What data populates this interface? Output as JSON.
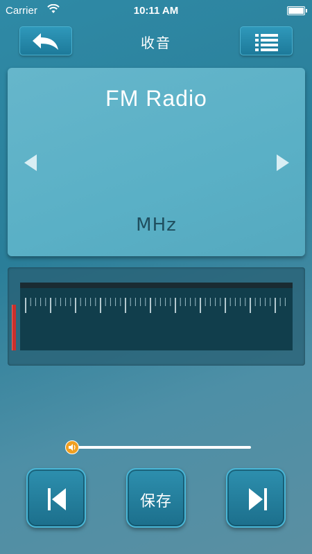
{
  "status_bar": {
    "carrier": "Carrier",
    "time": "10:11 AM"
  },
  "nav": {
    "title": "收音",
    "back_icon": "back-arrow-icon",
    "menu_icon": "list-icon"
  },
  "radio": {
    "band_title": "FM Radio",
    "unit": "MHz",
    "prev_station_icon": "left-triangle-icon",
    "next_station_icon": "right-triangle-icon"
  },
  "tuner": {
    "needle_position": 0
  },
  "volume": {
    "level": 0.03
  },
  "controls": {
    "prev_icon": "skip-previous-icon",
    "save_label": "保存",
    "next_icon": "skip-next-icon"
  },
  "colors": {
    "accent": "#2a8cad",
    "needle": "#c9302c",
    "volume_knob": "#f0a021"
  }
}
